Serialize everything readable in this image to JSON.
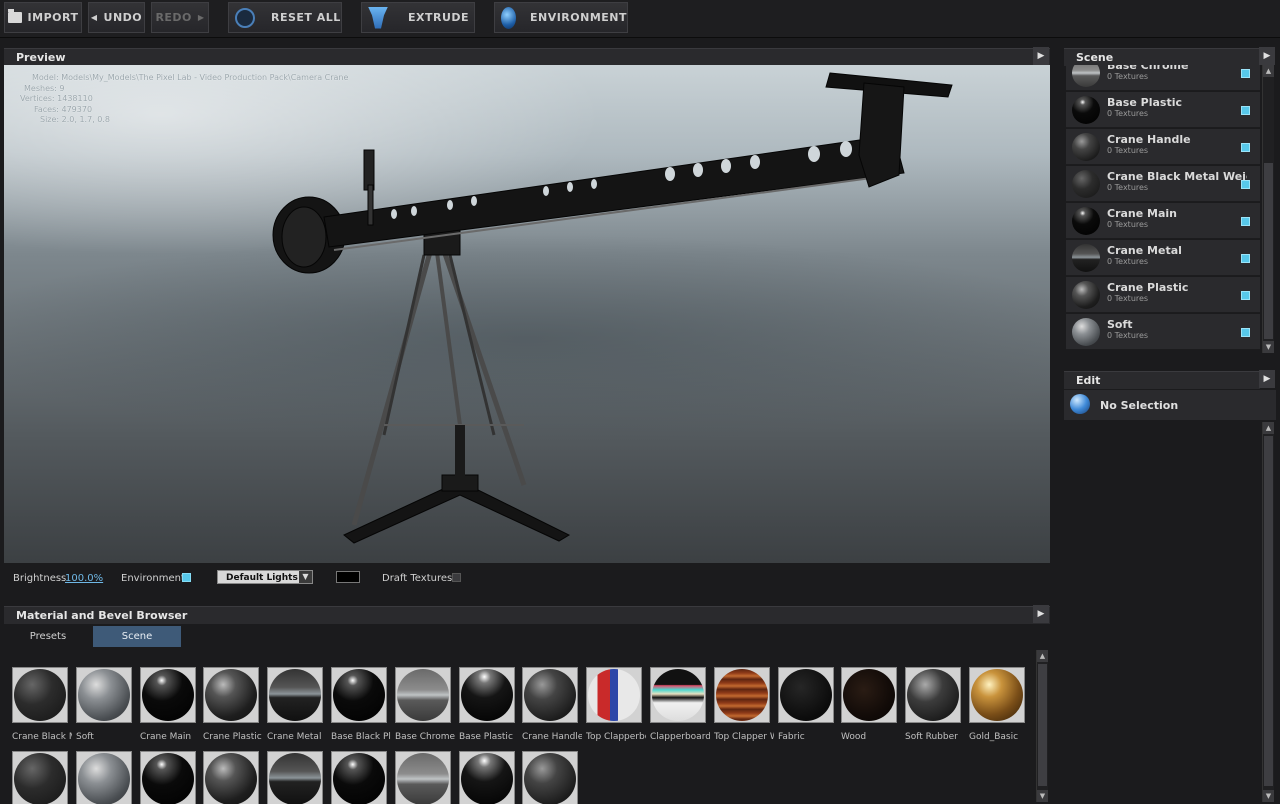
{
  "toolbar": {
    "import": "IMPORT",
    "undo": "UNDO",
    "redo": "REDO",
    "reset_all": "RESET ALL",
    "extrude": "EXTRUDE",
    "environment": "ENVIRONMENT"
  },
  "preview": {
    "title": "Preview",
    "model_info": {
      "model": "Model: Models\\My_Models\\The Pixel Lab - Video Production Pack\\Camera Crane",
      "meshes": "Meshes: 9",
      "vertices": "Vertices: 1438110",
      "faces": "Faces: 479370",
      "size": "Size: 2.0, 1.7, 0.8"
    },
    "brightness_label": "Brightness",
    "brightness_value": "100.0%",
    "environment_label": "Environment",
    "environment_checked": true,
    "lights_value": "Default Lights",
    "draft_textures_label": "Draft Textures",
    "draft_textures_checked": false
  },
  "scene_panel": {
    "title": "Scene",
    "items": [
      {
        "name": "Base Chrome",
        "textures": "0 Textures",
        "material": "chrome"
      },
      {
        "name": "Base Plastic",
        "textures": "0 Textures",
        "material": "gloss"
      },
      {
        "name": "Crane Handle",
        "textures": "0 Textures",
        "material": "handle"
      },
      {
        "name": "Crane Black Metal Weights",
        "textures": "0 Textures",
        "material": "dark"
      },
      {
        "name": "Crane Main",
        "textures": "0 Textures",
        "material": "gloss"
      },
      {
        "name": "Crane Metal",
        "textures": "0 Textures",
        "material": "metal"
      },
      {
        "name": "Crane Plastic",
        "textures": "0 Textures",
        "material": "plastic"
      },
      {
        "name": "Soft",
        "textures": "0 Textures",
        "material": "grey"
      }
    ]
  },
  "edit_panel": {
    "title": "Edit",
    "selection": "No Selection"
  },
  "browser": {
    "title": "Material and Bevel Browser",
    "tabs": [
      "Presets",
      "Scene"
    ],
    "active_tab": "Scene",
    "row1": [
      {
        "name": "Crane Black Metal Weights",
        "material": "dark"
      },
      {
        "name": "Soft",
        "material": "grey"
      },
      {
        "name": "Crane Main",
        "material": "gloss"
      },
      {
        "name": "Crane Plastic",
        "material": "plastic"
      },
      {
        "name": "Crane Metal",
        "material": "metal"
      },
      {
        "name": "Base Black Plastic",
        "material": "gloss"
      },
      {
        "name": "Base Chrome",
        "material": "chrome"
      },
      {
        "name": "Base Plastic",
        "material": "glossplastic"
      },
      {
        "name": "Crane Handle",
        "material": "handle"
      },
      {
        "name": "Top Clapperboard",
        "material": "clap1"
      },
      {
        "name": "Clapperboard",
        "material": "clap2"
      },
      {
        "name": "Top Clapper Wood",
        "material": "clap3"
      },
      {
        "name": "Fabric",
        "material": "fabric"
      },
      {
        "name": "Wood",
        "material": "wood"
      },
      {
        "name": "Soft Rubber",
        "material": "rubber"
      },
      {
        "name": "Gold_Basic",
        "material": "gold"
      }
    ],
    "row2": [
      "dark",
      "grey",
      "gloss",
      "plastic",
      "metal",
      "gloss",
      "chrome",
      "glossplastic",
      "handle"
    ]
  }
}
